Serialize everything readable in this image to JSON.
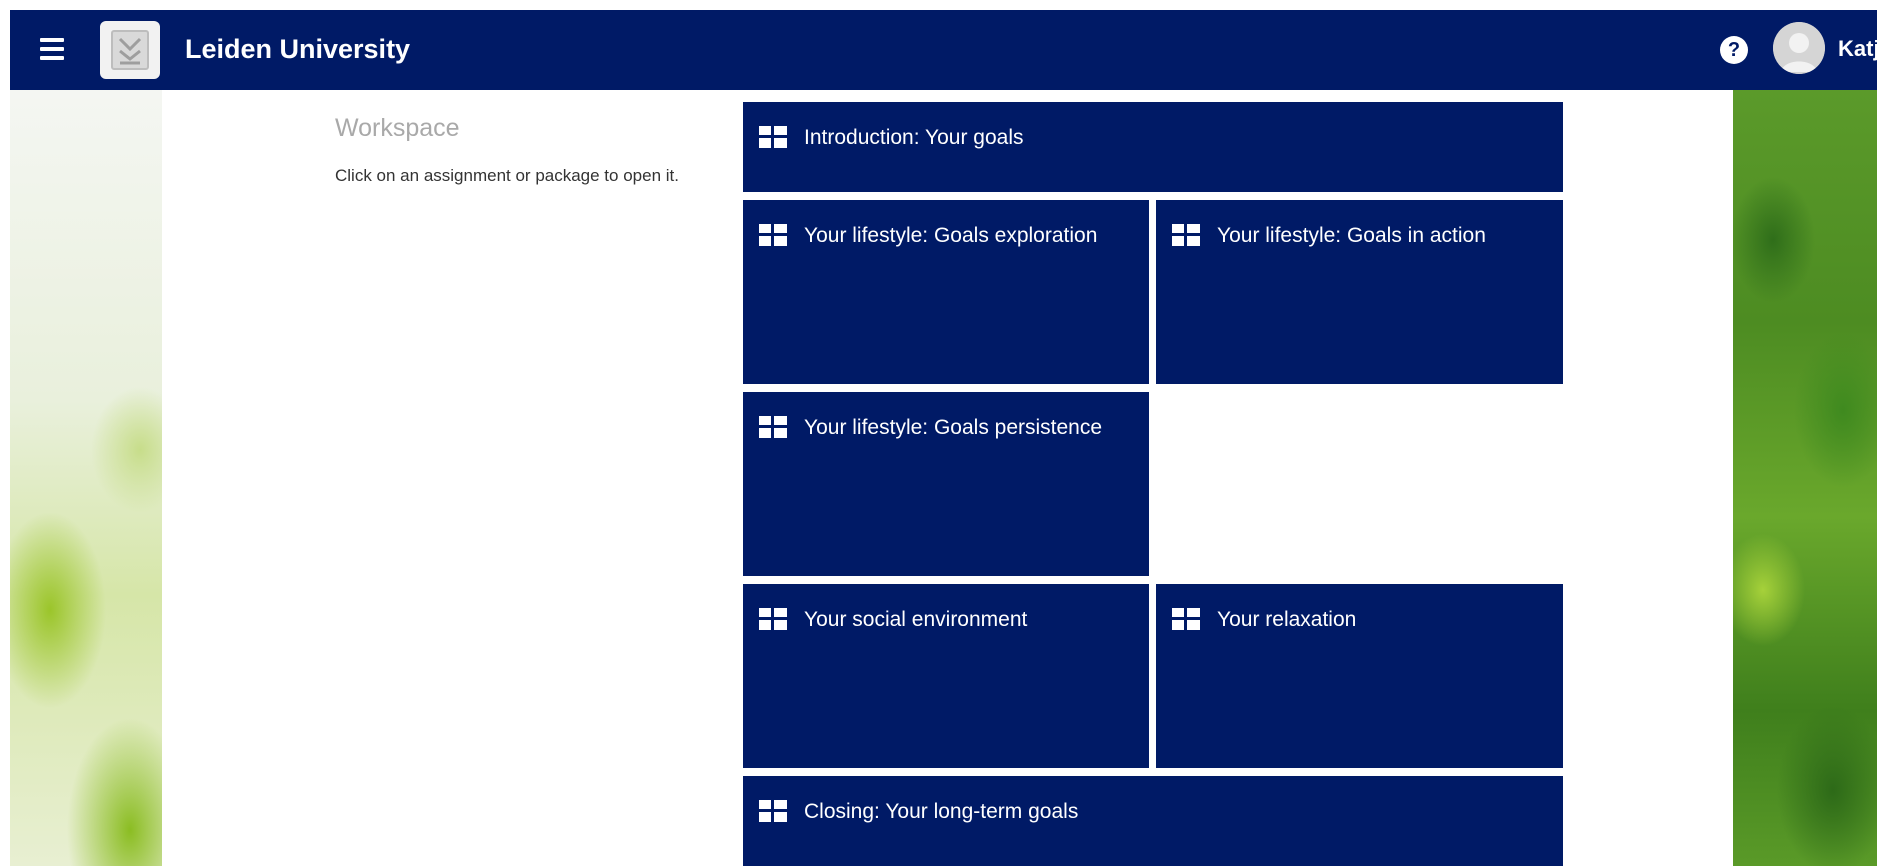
{
  "header": {
    "title": "Leiden University",
    "help_label": "?",
    "user_name": "Katj",
    "menu_icon": "hamburger-menu-icon",
    "logo_icon": "app-logo-icon",
    "avatar_icon": "user-avatar-icon"
  },
  "workspace": {
    "title": "Workspace",
    "hint": "Click on an assignment or package to open it."
  },
  "tiles": [
    {
      "label": "Introduction: Your goals"
    },
    {
      "label": "Your lifestyle:  Goals exploration"
    },
    {
      "label": "Your lifestyle:  Goals in action"
    },
    {
      "label": "Your lifestyle:  Goals persistence"
    },
    {
      "label": "Your social environment"
    },
    {
      "label": "Your relaxation"
    },
    {
      "label": "Closing: Your long-term goals"
    }
  ],
  "colors": {
    "primary": "#001a66",
    "text_on_primary": "#ffffff",
    "muted_title": "#a9a9a9"
  }
}
